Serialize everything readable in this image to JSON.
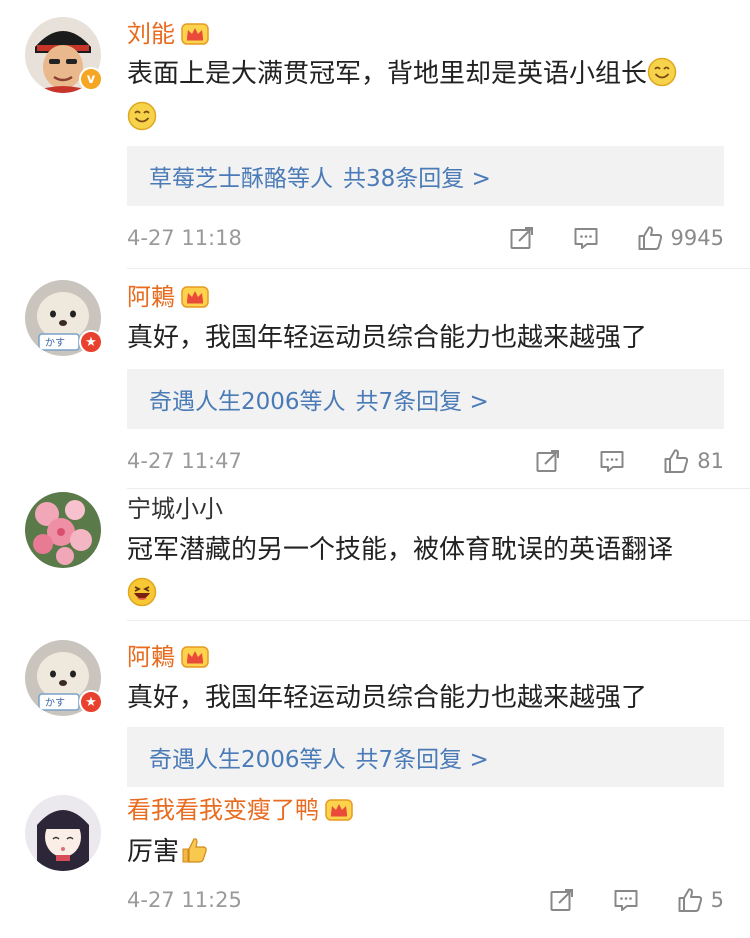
{
  "comments": [
    {
      "username": "刘能",
      "text": "表面上是大满贯冠军，背地里却是英语小组长",
      "reply_users": "草莓芝士酥酪等人",
      "reply_count": "共38条回复 >",
      "time": "4-27 11:18",
      "likes": "9945"
    },
    {
      "username": "阿鶫",
      "text": "真好，我国年轻运动员综合能力也越来越强了",
      "reply_users": "奇遇人生2006等人",
      "reply_count": "共7条回复 >",
      "time": "4-27 11:47",
      "likes": "81"
    },
    {
      "username": "宁城小小",
      "text": "冠军潜藏的另一个技能，被体育耽误的英语翻译"
    },
    {
      "username": "阿鶫",
      "text": "真好，我国年轻运动员综合能力也越来越强了",
      "reply_users": "奇遇人生2006等人",
      "reply_count": "共7条回复 >"
    },
    {
      "username": "看我看我变瘦了鸭",
      "text": "厉害",
      "time": "4-27 11:25",
      "likes": "5"
    }
  ],
  "icons": {
    "vip": "crown-icon",
    "share": "share-icon",
    "comment": "comment-icon",
    "like": "thumbs-up-icon",
    "emoji_smile": "smile-emoji-icon",
    "emoji_laugh": "laugh-emoji-icon",
    "emoji_thumb": "thumbs-up-emoji-icon"
  },
  "colors": {
    "vip_name": "#e86b1f",
    "reply_link": "#4a7bb7",
    "meta_gray": "#9a9a9a",
    "reply_bg": "#f2f2f2"
  }
}
